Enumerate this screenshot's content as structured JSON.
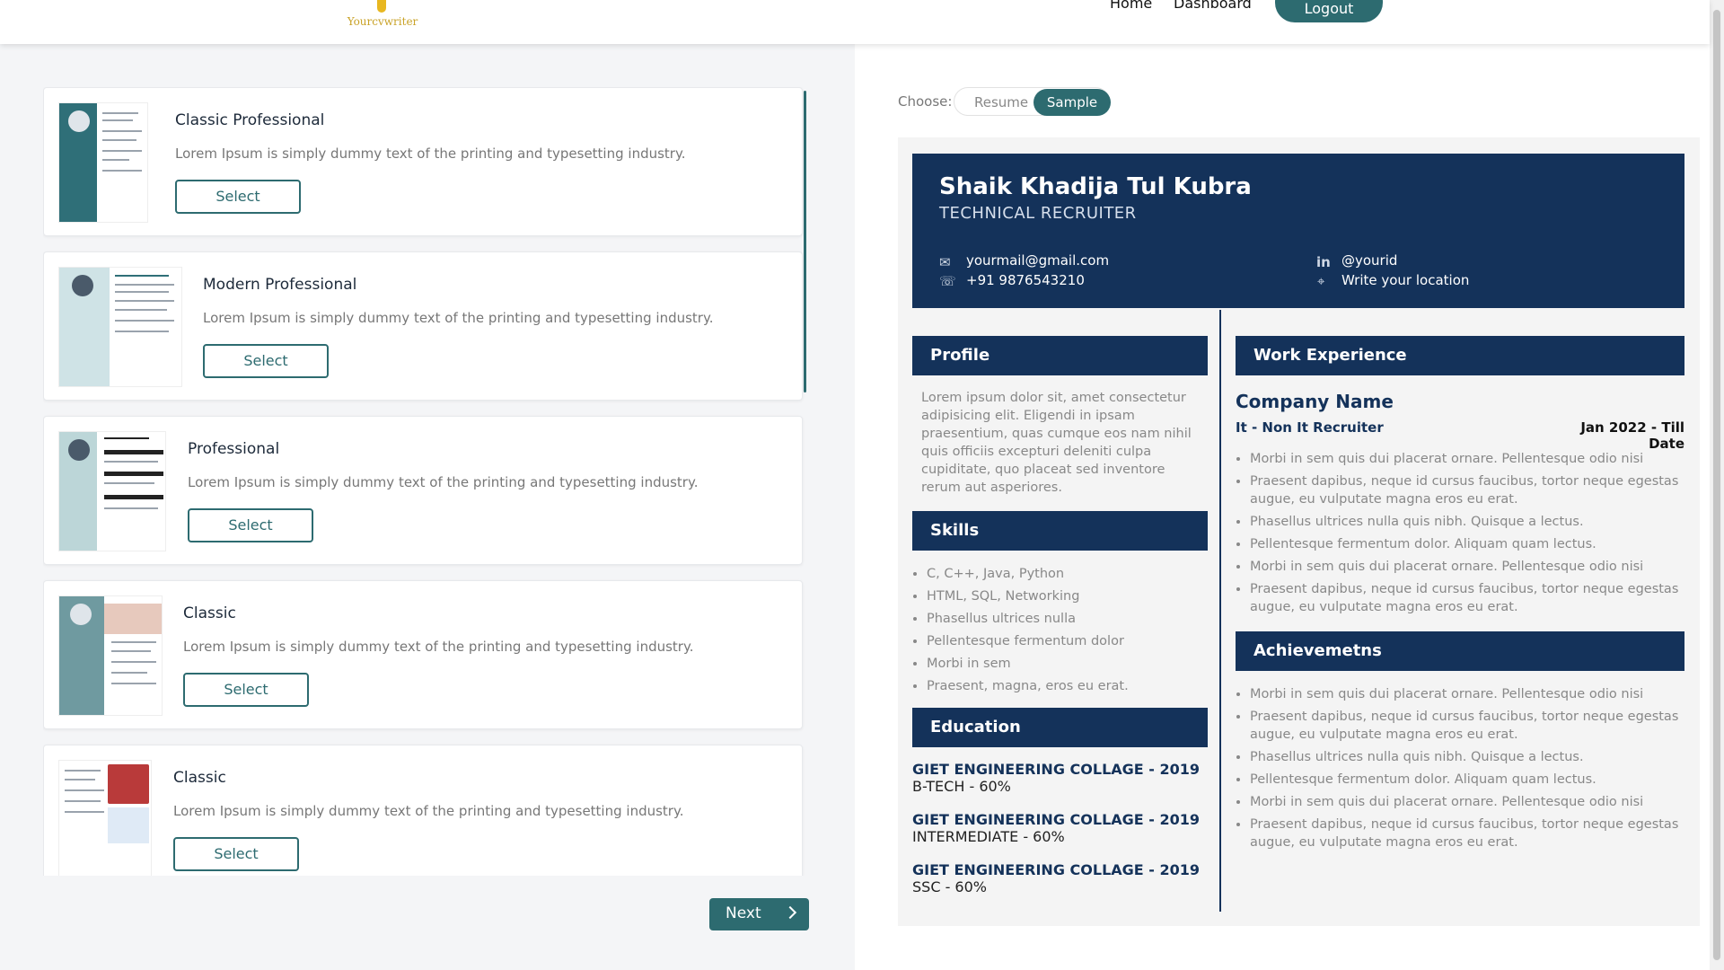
{
  "header": {
    "brand": "Yourcvwriter",
    "nav": {
      "home": "Home",
      "dashboard": "Dashboard"
    },
    "logout_label": "Logout"
  },
  "templates": [
    {
      "title": "Classic Professional",
      "description": "Lorem Ipsum is simply dummy text of the printing and typesetting industry.",
      "button": "Select"
    },
    {
      "title": "Modern Professional",
      "description": "Lorem Ipsum is simply dummy text of the printing and typesetting industry.",
      "button": "Select"
    },
    {
      "title": "Professional",
      "description": "Lorem Ipsum is simply dummy text of the printing and typesetting industry.",
      "button": "Select"
    },
    {
      "title": "Classic",
      "description": "Lorem Ipsum is simply dummy text of the printing and typesetting industry.",
      "button": "Select"
    },
    {
      "title": "Classic",
      "description": "Lorem Ipsum is simply dummy text of the printing and typesetting industry.",
      "button": "Select"
    }
  ],
  "next_label": "Next",
  "choose": {
    "label": "Choose:",
    "options": [
      "Resume",
      "Sample"
    ],
    "selected": "Sample"
  },
  "resume": {
    "name": "Shaik Khadija Tul Kubra",
    "role": "TECHNICAL RECRUITER",
    "contact": {
      "email": "yourmail@gmail.com",
      "phone": "+91 9876543210",
      "linkedin": "@yourid",
      "location": "Write your location"
    },
    "sections": {
      "profile": "Profile",
      "skills": "Skills",
      "education": "Education",
      "work": "Work Experience",
      "achievements": "Achievemetns"
    },
    "profile_text": "Lorem ipsum dolor sit, amet consectetur adipisicing elit. Eligendi in ipsam praesentium, quas cumque eos nam nihil quis officiis excepturi deleniti culpa cupiditate, quo placeat sed inventore rerum aut asperiores.",
    "skills": [
      "C, C++, Java, Python",
      "HTML, SQL, Networking",
      "Phasellus ultrices nulla",
      "Pellentesque fermentum dolor",
      "Morbi in sem",
      "Praesent, magna, eros eu erat."
    ],
    "education": [
      {
        "school": "GIET ENGINEERING COLLAGE - 2019",
        "degree": "B-TECH - 60%"
      },
      {
        "school": "GIET ENGINEERING COLLAGE - 2019",
        "degree": "INTERMEDIATE - 60%"
      },
      {
        "school": "GIET ENGINEERING COLLAGE - 2019",
        "degree": "SSC - 60%"
      }
    ],
    "work": {
      "company": "Company Name",
      "role": "It - Non It Recruiter",
      "dates": "Jan 2022 - Till Date",
      "bullets": [
        "Morbi in sem quis dui placerat ornare. Pellentesque odio nisi",
        "Praesent dapibus, neque id cursus faucibus, tortor neque egestas augue, eu vulputate magna eros eu erat.",
        "Phasellus ultrices nulla quis nibh. Quisque a lectus.",
        "Pellentesque fermentum dolor. Aliquam quam lectus.",
        "Morbi in sem quis dui placerat ornare. Pellentesque odio nisi",
        "Praesent dapibus, neque id cursus faucibus, tortor neque egestas augue, eu vulputate magna eros eu erat."
      ]
    },
    "achievements": [
      "Morbi in sem quis dui placerat ornare. Pellentesque odio nisi",
      "Praesent dapibus, neque id cursus faucibus, tortor neque egestas augue, eu vulputate magna eros eu erat.",
      "Phasellus ultrices nulla quis nibh. Quisque a lectus.",
      "Pellentesque fermentum dolor. Aliquam quam lectus.",
      "Morbi in sem quis dui placerat ornare. Pellentesque odio nisi",
      "Praesent dapibus, neque id cursus faucibus, tortor neque egestas augue, eu vulputate magna eros eu erat."
    ]
  },
  "colors": {
    "accent": "#2d6b70",
    "resume_navy": "#14325a",
    "brand_gold": "#c9a227"
  }
}
